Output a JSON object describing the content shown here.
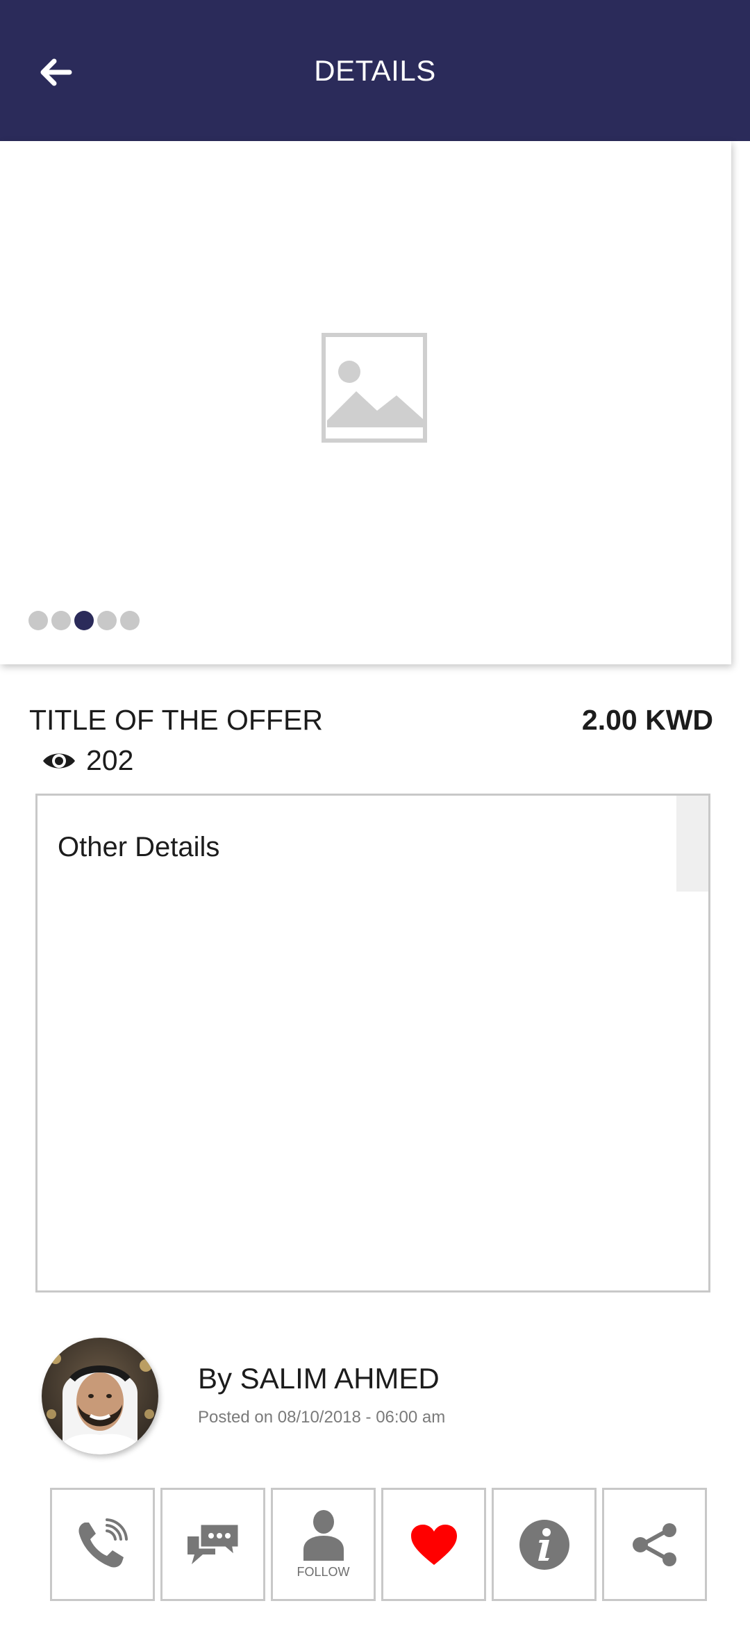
{
  "app_bar": {
    "title": "DETAILS",
    "back_icon": "arrow-left-icon",
    "background": "#2b2b5a"
  },
  "carousel": {
    "placeholder_icon": "image-placeholder-icon",
    "dots_count": 5,
    "active_dot_index": 2,
    "active_color": "#2b2b5a",
    "inactive_color": "#c8c8c8"
  },
  "offer": {
    "title": "TITLE OF THE OFFER",
    "price": "2.00 KWD",
    "views": "202",
    "views_icon": "eye-icon"
  },
  "details": {
    "label": "Other Details"
  },
  "author": {
    "name": "By SALIM AHMED",
    "posted": "Posted on 08/10/2018 - 06:00 am",
    "avatar_icon": "avatar"
  },
  "actions": [
    {
      "name": "call",
      "icon": "phone-icon",
      "label": ""
    },
    {
      "name": "message",
      "icon": "chat-icon",
      "label": ""
    },
    {
      "name": "follow",
      "icon": "user-icon",
      "label": "FOLLOW"
    },
    {
      "name": "favorite",
      "icon": "heart-icon",
      "label": "",
      "color": "#ff0000"
    },
    {
      "name": "info",
      "icon": "info-icon",
      "label": ""
    },
    {
      "name": "share",
      "icon": "share-icon",
      "label": ""
    }
  ]
}
